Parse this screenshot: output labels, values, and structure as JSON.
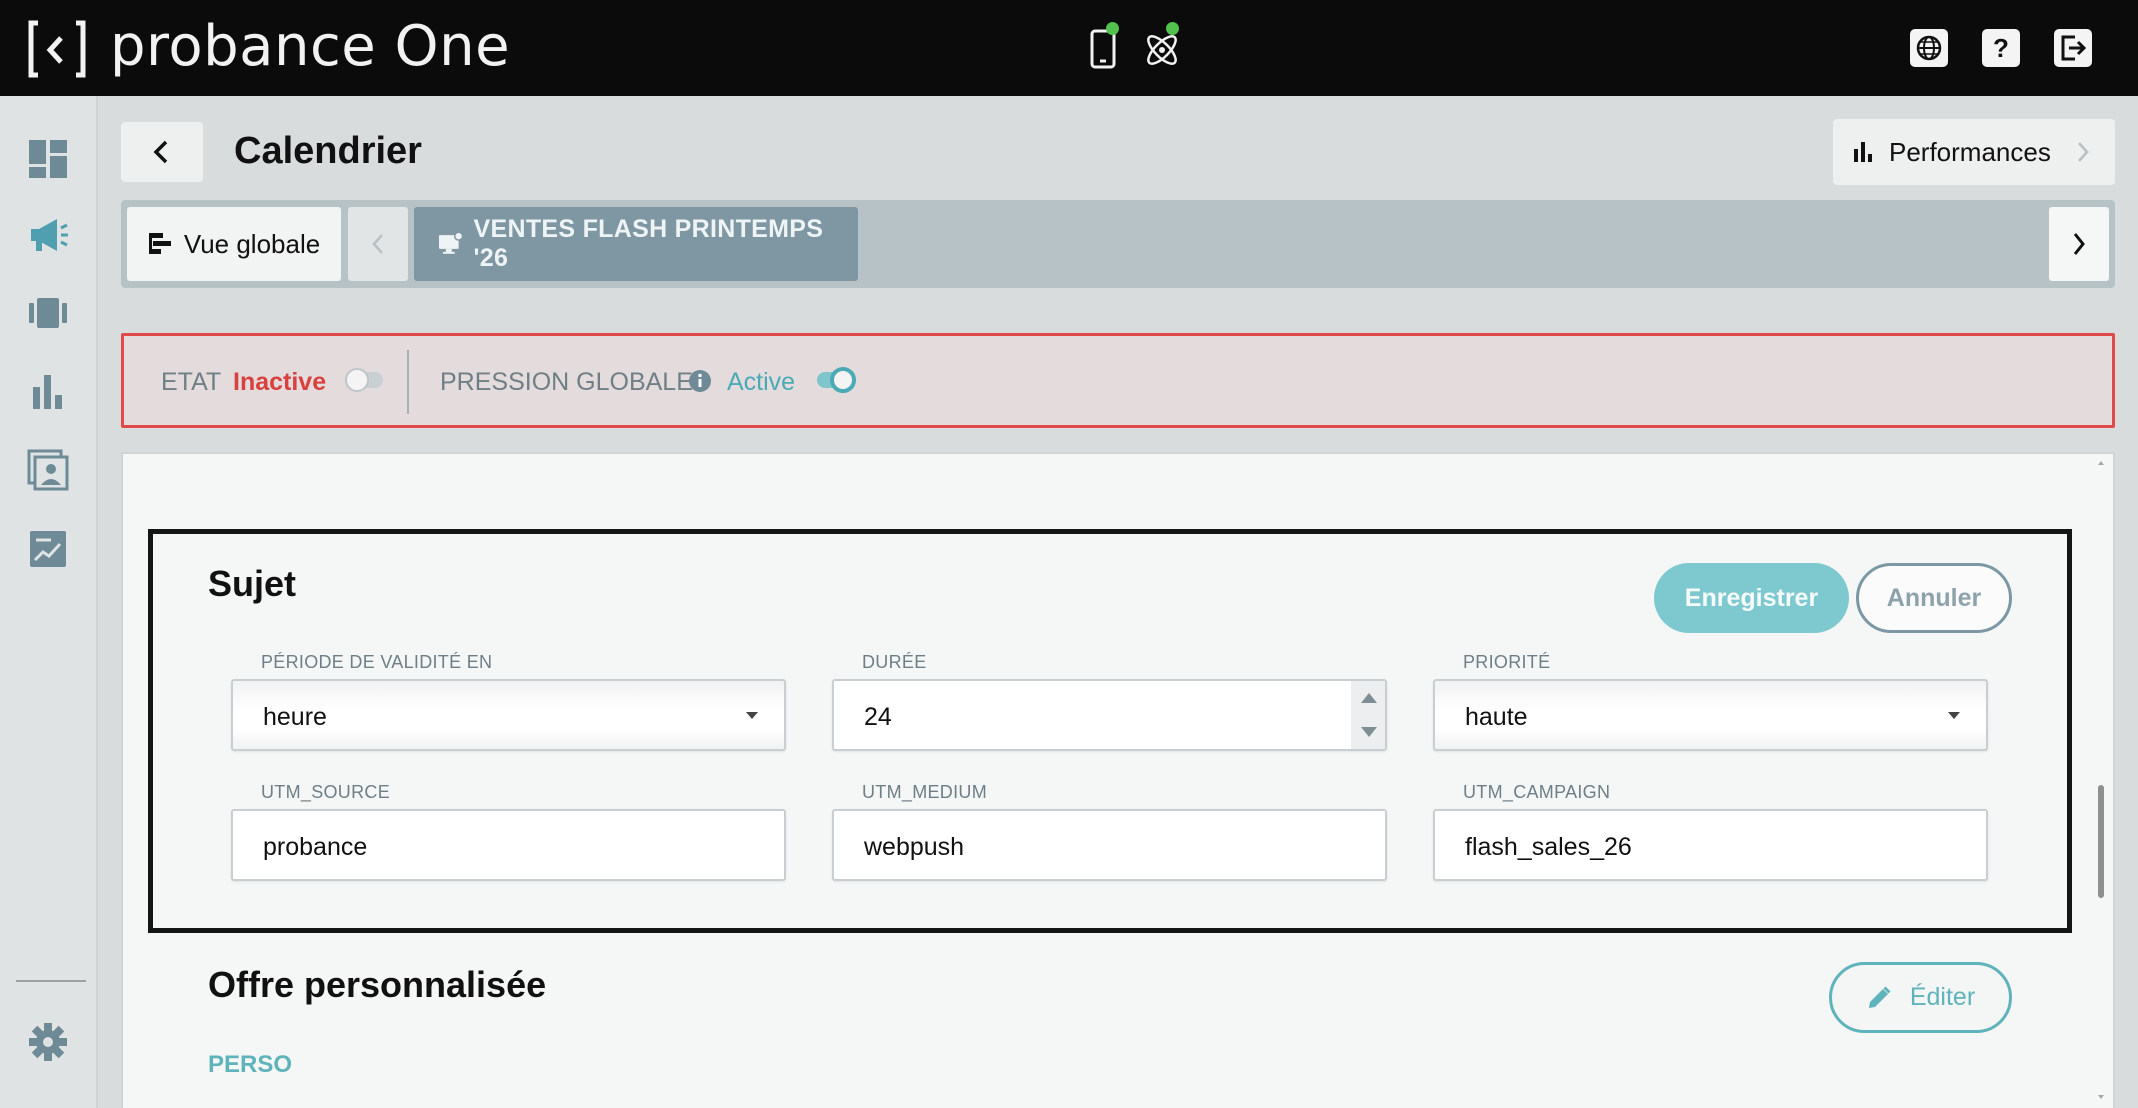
{
  "app": {
    "logo_text": "probance One"
  },
  "topbar": {
    "icons": [
      "mobile-icon",
      "atom-icon",
      "globe-icon",
      "help-icon",
      "logout-icon"
    ],
    "help_glyph": "?",
    "status_color": "#51c24e"
  },
  "sidebar": {
    "items": [
      "dashboard-icon",
      "megaphone-icon",
      "carousel-icon",
      "bar-chart-icon",
      "contacts-icon",
      "report-icon"
    ],
    "bottom": "gear-icon"
  },
  "header": {
    "title": "Calendrier",
    "performances_label": "Performances"
  },
  "breadcrumb": {
    "home_label": "Vue globale",
    "current_label": "VENTES FLASH PRINTEMPS '26"
  },
  "status": {
    "etat_label": "ETAT",
    "etat_value": "Inactive",
    "etat_on": false,
    "pression_label": "PRESSION GLOBALE",
    "pression_value": "Active",
    "pression_on": true
  },
  "sujet": {
    "title": "Sujet",
    "save_label": "Enregistrer",
    "cancel_label": "Annuler",
    "fields": {
      "periode": {
        "label": "PÉRIODE DE VALIDITÉ EN",
        "value": "heure"
      },
      "duree": {
        "label": "DURÉE",
        "value": "24"
      },
      "priorite": {
        "label": "PRIORITÉ",
        "value": "haute"
      },
      "utm_source": {
        "label": "UTM_SOURCE",
        "value": "probance"
      },
      "utm_medium": {
        "label": "UTM_MEDIUM",
        "value": "webpush"
      },
      "utm_campaign": {
        "label": "UTM_CAMPAIGN",
        "value": "flash_sales_26"
      }
    }
  },
  "offre": {
    "title": "Offre personnalisée",
    "edit_label": "Éditer",
    "perso_label": "PERSO"
  },
  "colors": {
    "accent": "#5fb3ba",
    "danger": "#d9413f",
    "breadcrumb_active": "#7f97a3"
  }
}
